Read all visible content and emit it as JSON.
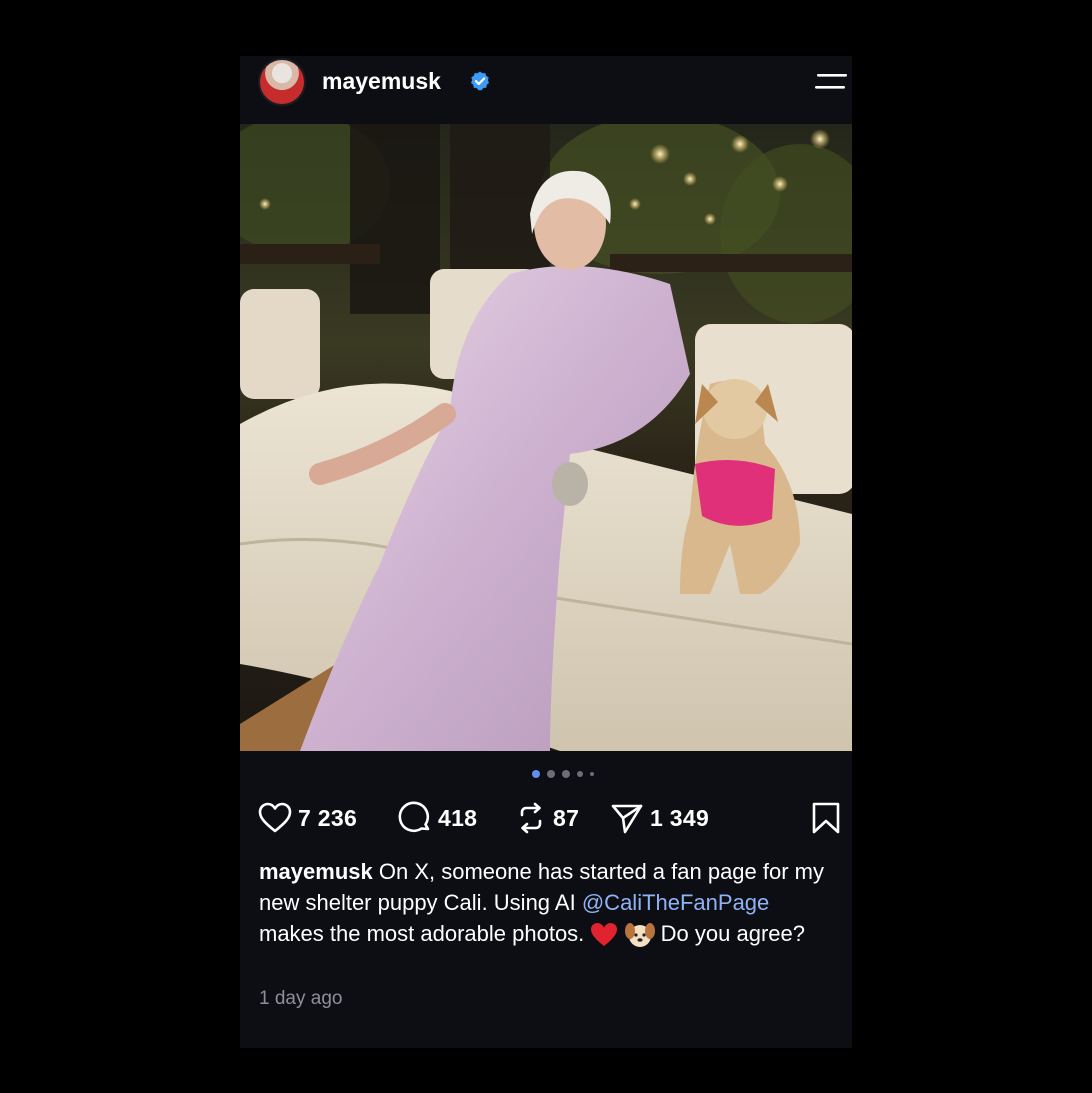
{
  "post": {
    "username": "mayemusk",
    "verified": true,
    "avatar_icon": "avatar-photo",
    "menu_icon": "menu-icon",
    "carousel": {
      "total": 5,
      "active": 1
    },
    "actions": {
      "likes": "7 236",
      "comments": "418",
      "reposts": "87",
      "shares": "1 349"
    },
    "caption": {
      "username": "mayemusk",
      "text_before": " On X, someone has started a fan page for my new shelter puppy Cali. Using AI ",
      "mention": "@CaliTheFanPage",
      "text_after": " makes the most adorable photos. ",
      "emoji_heart": "❤️",
      "emoji_dog": "🐶",
      "text_end": " Do you agree?"
    },
    "timestamp": "1 day ago"
  },
  "colors": {
    "background": "#000000",
    "card": "#0d0e14",
    "verified_blue": "#3b9cf6",
    "mention": "#8fb3f5",
    "muted": "#8e8f98",
    "dot_active": "#5f8ff0"
  }
}
